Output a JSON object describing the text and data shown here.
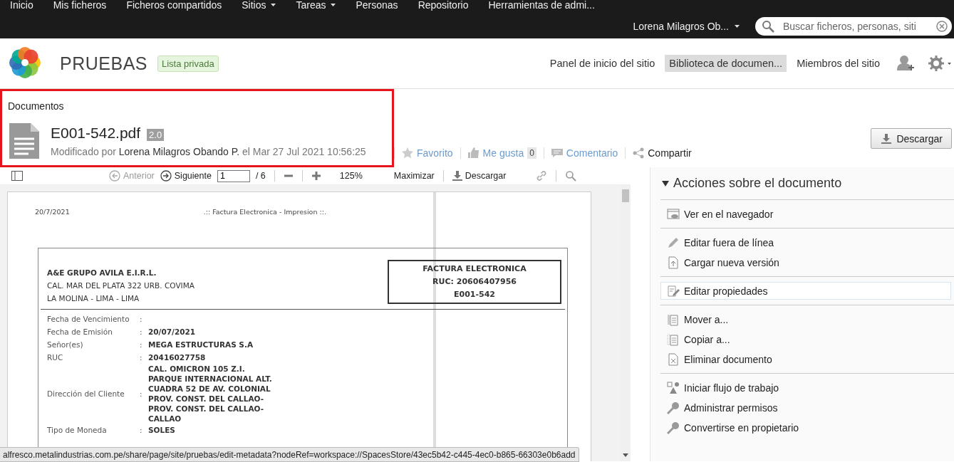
{
  "top_nav": [
    {
      "label": "Inicio",
      "dropdown": false
    },
    {
      "label": "Mis ficheros",
      "dropdown": false
    },
    {
      "label": "Ficheros compartidos",
      "dropdown": false
    },
    {
      "label": "Sitios",
      "dropdown": true
    },
    {
      "label": "Tareas",
      "dropdown": true
    },
    {
      "label": "Personas",
      "dropdown": false
    },
    {
      "label": "Repositorio",
      "dropdown": false
    },
    {
      "label": "Herramientas de admi...",
      "dropdown": false
    }
  ],
  "user_menu": {
    "label": "Lorena Milagros Ob..."
  },
  "search": {
    "placeholder": "Buscar ficheros, personas, siti"
  },
  "site": {
    "title": "PRUEBAS",
    "visibility": "Lista privada",
    "nav": [
      {
        "label": "Panel de inicio del sitio",
        "selected": false
      },
      {
        "label": "Biblioteca de documen...",
        "selected": true
      },
      {
        "label": "Miembros del sitio",
        "selected": false
      }
    ]
  },
  "document": {
    "breadcrumb": "Documentos",
    "name": "E001-542.pdf",
    "version": "2.0",
    "highlighted": true,
    "modified_prefix": "Modificado por",
    "modifier": "Lorena Milagros Obando P.",
    "modified_date": "el Mar 27 Jul 2021 10:56:25",
    "actions": [
      {
        "kind": "favorite",
        "label": "Favorito"
      },
      {
        "kind": "like",
        "label": "Me gusta",
        "count": "0"
      },
      {
        "kind": "comment",
        "label": "Comentario"
      },
      {
        "kind": "share",
        "label": "Compartir"
      }
    ],
    "download_button": "Descargar"
  },
  "viewer_toolbar": {
    "previous": {
      "label": "Anterior",
      "disabled": true
    },
    "next": {
      "label": "Siguiente",
      "disabled": false
    },
    "page": "1",
    "page_total": "/ 6",
    "zoom": "125%",
    "maximize": "Maximizar",
    "download": "Descargar"
  },
  "invoice": {
    "print_date": "20/7/2021",
    "print_title": ".:: Factura Electronica - Impresion ::.",
    "issuer": "A&E GRUPO AVILA E.I.R.L.",
    "issuer_address": [
      "CAL. MAR DEL PLATA 322 URB. COVIMA",
      "LA MOLINA - LIMA - LIMA"
    ],
    "doc_box": [
      "FACTURA ELECTRONICA",
      "RUC: 20606407956",
      "E001-542"
    ],
    "fields": [
      {
        "label": "Fecha de Vencimiento",
        "separator": ":"
      },
      {
        "label": "Fecha de Emisión",
        "separator": ":",
        "value": [
          "20/07/2021"
        ]
      },
      {
        "label": "Señor(es)",
        "separator": ":",
        "value": [
          "MEGA ESTRUCTURAS S.A"
        ]
      },
      {
        "label": "RUC",
        "separator": ":",
        "value": [
          "20416027758"
        ]
      },
      {
        "label": "Dirección del Cliente",
        "separator": ":",
        "value": [
          "CAL. OMICRON 105 Z.I.",
          "PARQUE INTERNACIONAL ALT.",
          "CUADRA 52 DE AV. COLONIAL",
          "PROV. CONST. DEL CALLAO-",
          "PROV. CONST. DEL CALLAO-",
          "CALLAO"
        ]
      },
      {
        "label": "Tipo de Moneda",
        "separator": ":",
        "value": [
          "SOLES"
        ]
      }
    ]
  },
  "actions_panel": {
    "title": "Acciones sobre el documento",
    "expanded": true,
    "groups": [
      [
        {
          "kind": "view",
          "label": "Ver en el navegador",
          "selected": false
        }
      ],
      [
        {
          "kind": "edit",
          "label": "Editar fuera de línea",
          "selected": false
        },
        {
          "kind": "upload",
          "label": "Cargar nueva versión",
          "selected": false
        }
      ],
      [
        {
          "kind": "properties",
          "label": "Editar propiedades",
          "selected": true
        }
      ],
      [
        {
          "kind": "move",
          "label": "Mover a...",
          "selected": false
        },
        {
          "kind": "copy",
          "label": "Copiar a...",
          "selected": false
        },
        {
          "kind": "delete",
          "label": "Eliminar documento",
          "selected": false
        }
      ],
      [
        {
          "kind": "workflow",
          "label": "Iniciar flujo de trabajo",
          "selected": false
        },
        {
          "kind": "key",
          "label": "Administrar permisos",
          "selected": false
        },
        {
          "kind": "key",
          "label": "Convertirse en propietario",
          "selected": false
        }
      ]
    ]
  },
  "status_url": "alfresco.metalindustrias.com.pe/share/page/site/pruebas/edit-metadata?nodeRef=workspace://SpacesStore/43ec5b42-c445-4ec0-b865-66303e0b6add"
}
